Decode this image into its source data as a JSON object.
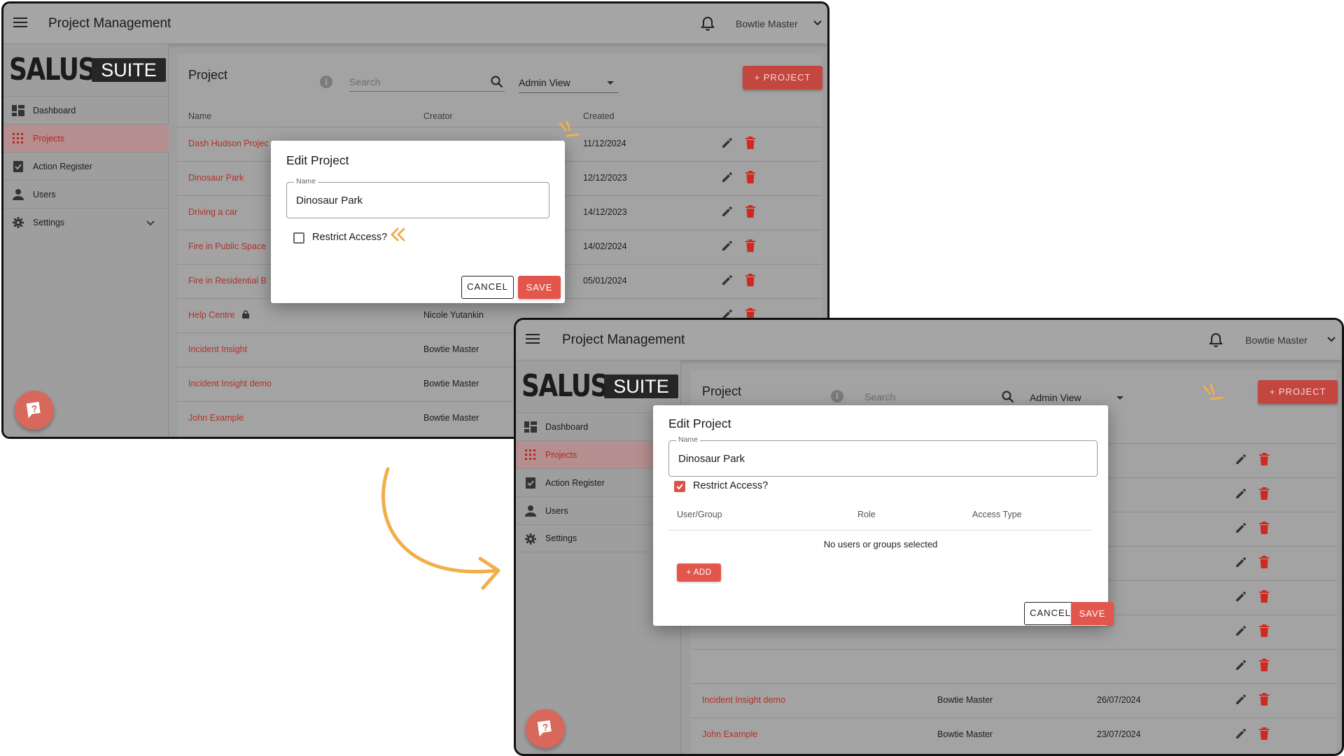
{
  "app": {
    "title": "Project Management",
    "user_name": "Bowtie Master",
    "logo": "SALUS SUITE",
    "logo_word1": "SALUS",
    "logo_word2": "SUITE"
  },
  "sidebar": {
    "items": [
      {
        "label": "Dashboard",
        "icon": "dashboard-icon"
      },
      {
        "label": "Projects",
        "icon": "grid-icon",
        "active": true
      },
      {
        "label": "Action Register",
        "icon": "clipboard-check-icon"
      },
      {
        "label": "Users",
        "icon": "person-icon"
      },
      {
        "label": "Settings",
        "icon": "gear-icon",
        "expandable": true
      }
    ]
  },
  "main": {
    "page_title": "Project",
    "search_placeholder": "Search",
    "view_select": "Admin View",
    "add_project_label": "+ PROJECT",
    "columns": [
      "Name",
      "Creator",
      "Created"
    ],
    "rows_left": [
      {
        "name": "Dash Hudson Projec",
        "creator": "",
        "created": "11/12/2024"
      },
      {
        "name": "Dinosaur Park",
        "creator": "",
        "created": "12/12/2023"
      },
      {
        "name": "Driving a car",
        "creator": "",
        "created": "14/12/2023"
      },
      {
        "name": "Fire in Public Space",
        "creator": "",
        "created": "14/02/2024"
      },
      {
        "name": "Fire in Residential B",
        "creator": "",
        "created": "05/01/2024"
      },
      {
        "name": "Help Centre",
        "creator": "Nicole Yutankin",
        "created": "",
        "locked": true
      },
      {
        "name": "Incident Insight",
        "creator": "Bowtie Master",
        "created": ""
      },
      {
        "name": "Incident Insight demo",
        "creator": "Bowtie Master",
        "created": ""
      },
      {
        "name": "John Example",
        "creator": "Bowtie Master",
        "created": ""
      }
    ],
    "rows_right": [
      {
        "name": "Incident Insight demo",
        "creator": "Bowtie Master",
        "created": "26/07/2024"
      },
      {
        "name": "John Example",
        "creator": "Bowtie Master",
        "created": "23/07/2024"
      }
    ]
  },
  "dialog": {
    "title": "Edit Project",
    "name_label": "Name",
    "name_value": "Dinosaur Park",
    "restrict_label": "Restrict Access?",
    "restrict_before": false,
    "restrict_after": true,
    "access_columns": [
      "User/Group",
      "Role",
      "Access Type"
    ],
    "empty_message": "No users or groups selected",
    "add_label": "+ ADD",
    "cancel_label": "CANCEL",
    "save_label": "SAVE"
  },
  "colors": {
    "accent": "#e3564c",
    "link_red": "#b0322a",
    "annotation": "#f2ae4a",
    "overlay_gray": "#9e9e9e"
  }
}
